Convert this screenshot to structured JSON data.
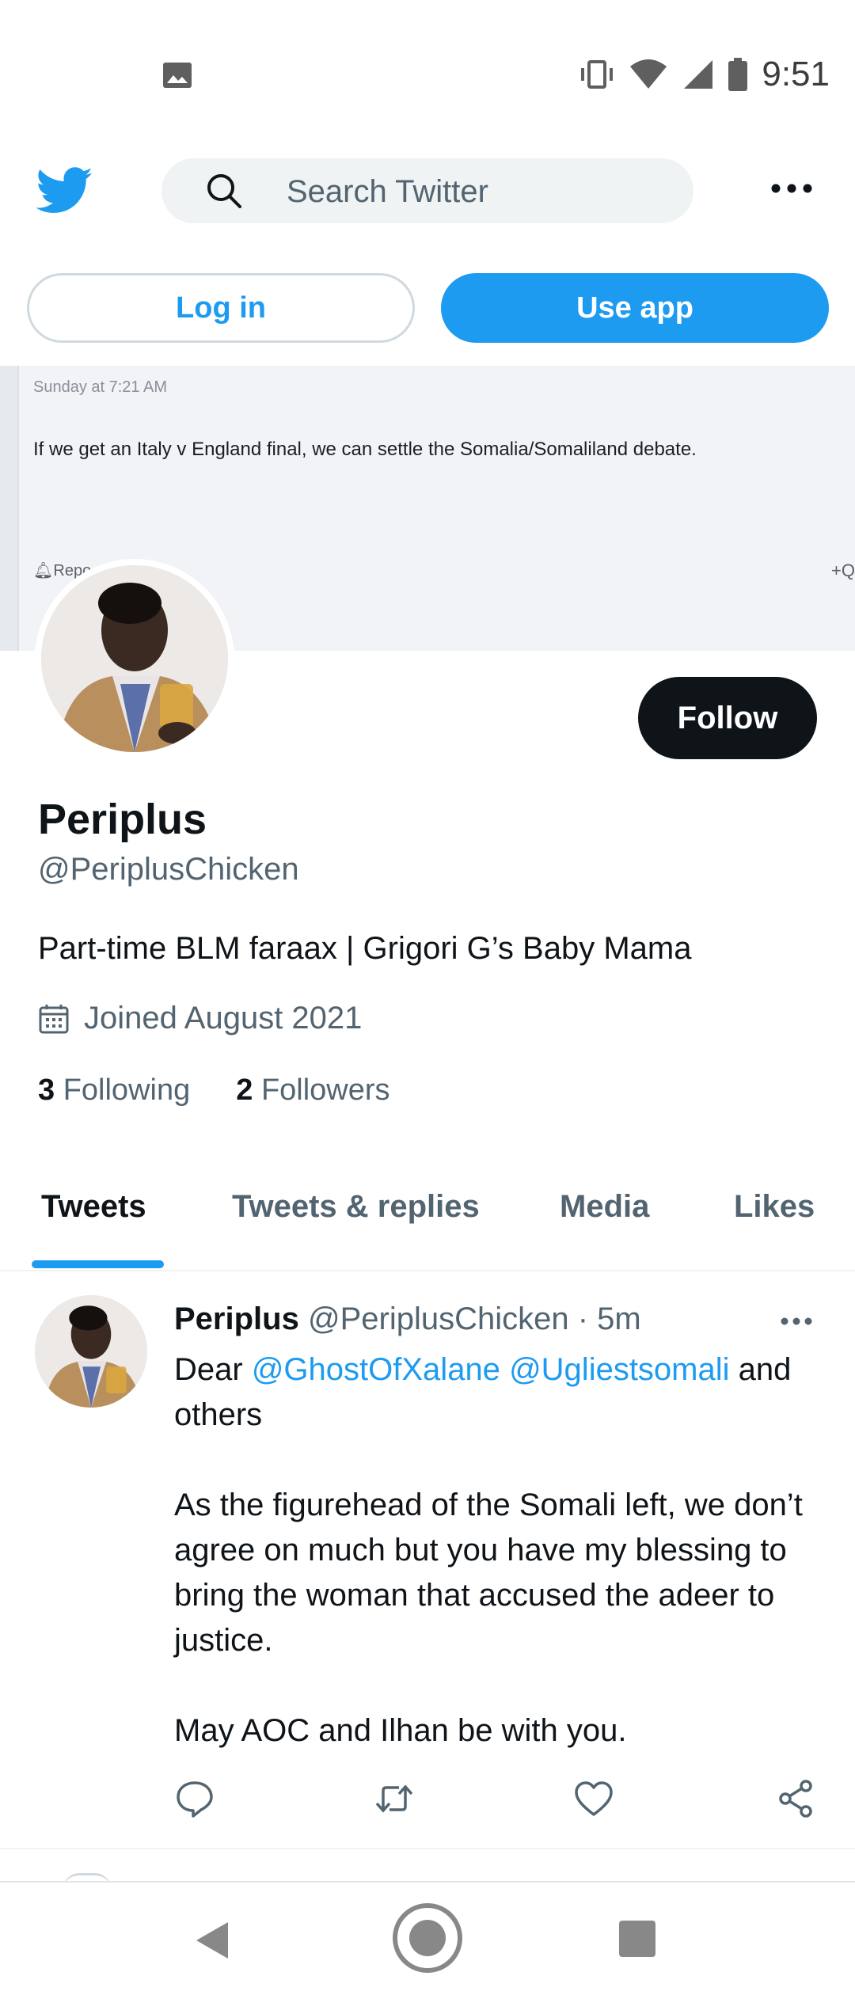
{
  "status_bar": {
    "time": "9:51",
    "left_icons": [
      "image-icon"
    ],
    "right_icons": [
      "vibrate-icon",
      "wifi-icon",
      "signal-icon",
      "battery-icon"
    ]
  },
  "header": {
    "logo": "twitter-bird-icon",
    "search_placeholder": "Search Twitter",
    "more": "more-icon"
  },
  "auth": {
    "login_label": "Log in",
    "use_app_label": "Use app"
  },
  "banner": {
    "timestamp": "Sunday at 7:21 AM",
    "text": "If we get an Italy v England final, we can settle the Somalia/Somaliland debate.",
    "report_label": "Repo",
    "plus_label": "+Q"
  },
  "profile": {
    "follow_label": "Follow",
    "name": "Periplus",
    "handle": "@PeriplusChicken",
    "bio": "Part-time BLM faraax | Grigori G’s Baby Mama",
    "joined": "Joined August 2021",
    "following_count": "3",
    "following_label": "Following",
    "followers_count": "2",
    "followers_label": "Followers"
  },
  "tabs": [
    "Tweets",
    "Tweets & replies",
    "Media",
    "Likes"
  ],
  "tweet": {
    "name": "Periplus",
    "handle": "@PeriplusChicken",
    "separator": " · ",
    "time": "5m",
    "greeting": "Dear",
    "mention1": "@GhostOfXalane",
    "mention2": "@Ugliestsomali",
    "after_mentions": "and",
    "others": "others",
    "paragraph2": "As the figurehead of the Somali left, we don’t agree on much but you have my blessing to bring the woman that accused the adeer to justice.",
    "paragraph3": "May AOC and Ilhan be with you."
  },
  "colors": {
    "brand": "#1d9bf0",
    "text": "#0f1419",
    "muted": "#536471"
  }
}
